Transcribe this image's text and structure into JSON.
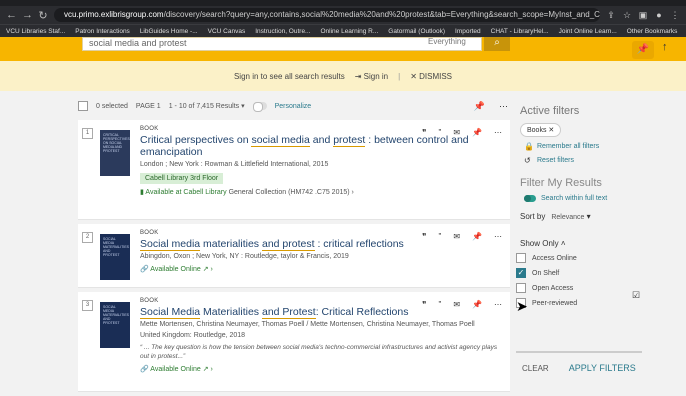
{
  "browser": {
    "url_prefix": "vcu.primo.exlibrisgroup.com",
    "url_rest": "/discovery/search?query=any,contains,social%20media%20and%20protest&tab=Everything&search_scope=MyInst_and_CI&vid=01VCU_INST:VCU&mfacet=rtype,in...",
    "bookmarks": [
      "VCU Libraries Staf...",
      "Patron Interactions",
      "LibGuides Home -...",
      "VCU Canvas",
      "Instruction, Outre...",
      "Online Learning R...",
      "Gatormail (Outlook)",
      "Imported",
      "CHAT - LibraryHel...",
      "Joint Online Learn...",
      "Other Bookmarks"
    ]
  },
  "search": {
    "query": "social media and protest",
    "scope": "Everything"
  },
  "signin_bar": {
    "text": "Sign in to see all search results",
    "signin": "Sign in",
    "dismiss": "DISMISS"
  },
  "toolbar": {
    "selected": "0 selected",
    "page": "PAGE 1",
    "range": "1 - 10 of 7,415 Results",
    "personalize": "Personalize"
  },
  "results": [
    {
      "num": "1",
      "type": "BOOK",
      "title_a": "Critical perspectives on ",
      "title_hl1": "social media",
      "title_b": " and ",
      "title_hl2": "protest",
      "title_c": " : between control and emancipation",
      "meta": "London ; New York : Rowman & Littlefield International, 2015",
      "location_tag": "Cabell Library 3rd Floor",
      "avail": "Available at Cabell Library",
      "avail_detail": " General Collection (HM742 .C75 2015) ›"
    },
    {
      "num": "2",
      "type": "BOOK",
      "title_a": "",
      "title_hl1": "Social media",
      "title_b": " materialities ",
      "title_hl2": "and protest",
      "title_c": " : critical reflections",
      "meta": "Abingdon, Oxon ; New York, NY : Routledge, taylor & Francis, 2019",
      "avail": "Available Online"
    },
    {
      "num": "3",
      "type": "BOOK",
      "title_a": "",
      "title_hl1": "Social Media",
      "title_b": " Materialities ",
      "title_hl2": "and Protest",
      "title_c": ": Critical Reflections",
      "meta": "Mette Mortensen, Christina Neumayer, Thomas Poell / Mette Mortensen, Christina Neumayer, Thomas Poell",
      "meta2": "United Kingdom: Routledge, 2018",
      "abstract": "“ ... The key question is how the tension between social media's techno-commercial infrastructures and activist agency plays out in protest...”",
      "avail": "Available Online"
    }
  ],
  "sidebar": {
    "active_filters": "Active filters",
    "chip": "Books",
    "remember": "Remember all filters",
    "reset": "Reset filters",
    "filter_heading": "Filter My Results",
    "fulltext": "Search within full text",
    "sort_by": "Sort by",
    "sort_value": "Relevance",
    "show_only": "Show Only",
    "options": [
      {
        "label": "Access Online",
        "checked": false
      },
      {
        "label": "On Shelf",
        "checked": true
      },
      {
        "label": "Open Access",
        "checked": false
      },
      {
        "label": "Peer-reviewed",
        "checked": false
      }
    ],
    "clear": "CLEAR",
    "apply": "APPLY FILTERS"
  }
}
